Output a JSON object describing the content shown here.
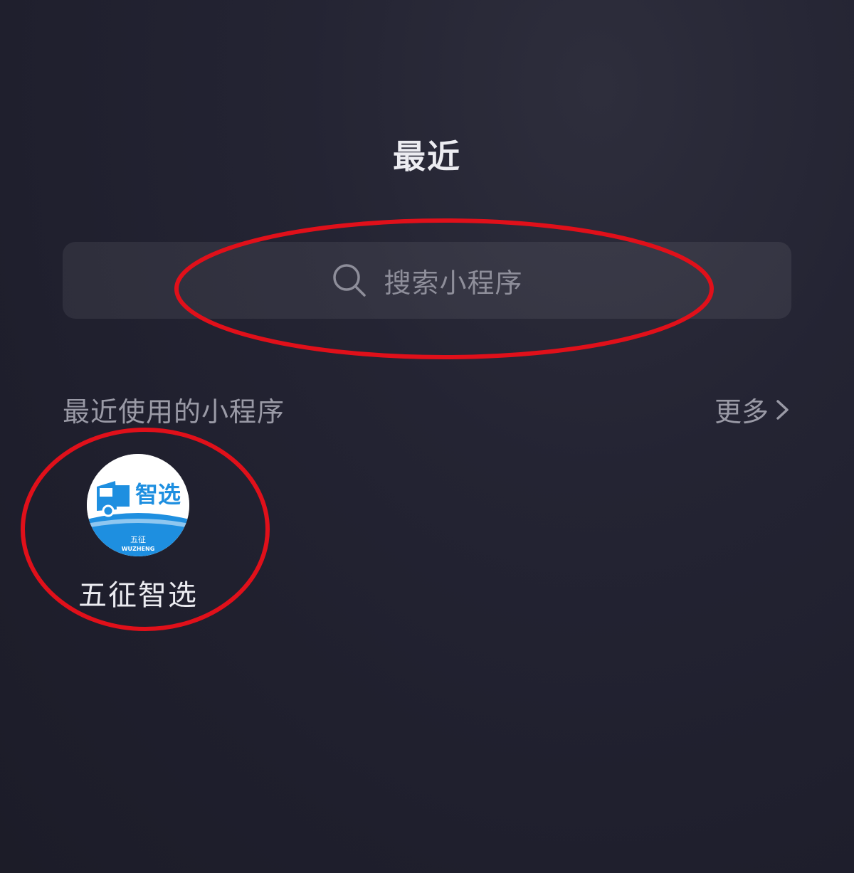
{
  "header": {
    "title": "最近"
  },
  "search": {
    "placeholder": "搜索小程序",
    "icon": "search-icon"
  },
  "recent_section": {
    "title": "最近使用的小程序",
    "more_label": "更多",
    "more_icon": "chevron-right-icon"
  },
  "recent_apps": [
    {
      "name": "五征智选",
      "logo_text": "智选",
      "logo_subtext": "五征",
      "logo_brand": "WUZHENG",
      "logo_color": "#1e8fe0"
    }
  ],
  "colors": {
    "background": "#22222f",
    "annotation": "#e0101a",
    "accent_blue": "#1e8fe0"
  }
}
